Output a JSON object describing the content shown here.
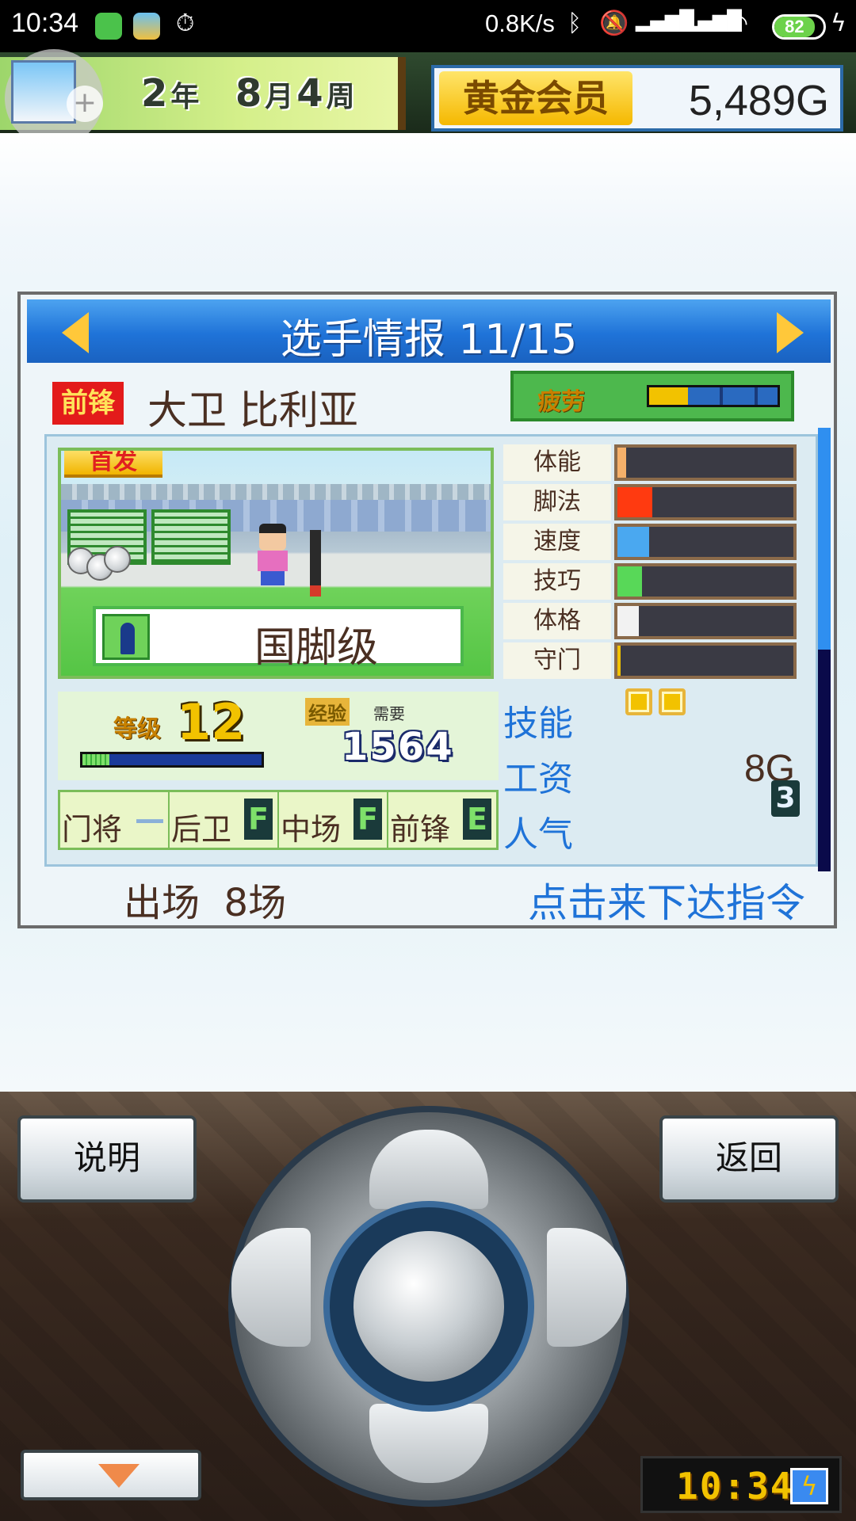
{
  "status_bar": {
    "time": "10:34",
    "net_speed": "0.8K/s",
    "battery": "82",
    "icons": [
      "game-app-icon",
      "photo-app-icon",
      "timer-icon",
      "bluetooth-icon",
      "mute-icon",
      "signal-hd-icon",
      "signal-hd-icon",
      "wifi-icon",
      "charging-icon"
    ]
  },
  "header": {
    "year": "2",
    "year_unit": "年",
    "month": "8",
    "month_unit": "月",
    "week": "4",
    "week_unit": "周",
    "member_label": "黄金会员",
    "gold": "5,489G"
  },
  "card": {
    "title": "选手情报 11/15",
    "position_tag": "前锋",
    "player_name": "大卫 比利亚",
    "fatigue_label": "疲劳",
    "fatigue": {
      "yellow": 0.3,
      "blue": 0.7
    },
    "start_tag": "首发",
    "rank": "国脚级",
    "level_label": "等级",
    "level": "12",
    "exp_label": "经验",
    "exp_need_label": "需要",
    "exp_need": "1564",
    "exp_progress": 0.15,
    "positions": [
      {
        "name": "门将",
        "grade": "—"
      },
      {
        "name": "后卫",
        "grade": "F"
      },
      {
        "name": "中场",
        "grade": "F"
      },
      {
        "name": "前锋",
        "grade": "E"
      }
    ],
    "stats": [
      {
        "label": "体能",
        "value": 0.05,
        "color": "#f5b06a"
      },
      {
        "label": "脚法",
        "value": 0.2,
        "color": "#ff3a10"
      },
      {
        "label": "速度",
        "value": 0.18,
        "color": "#4aa8f0"
      },
      {
        "label": "技巧",
        "value": 0.14,
        "color": "#58d858"
      },
      {
        "label": "体格",
        "value": 0.12,
        "color": "#f2f2f2"
      },
      {
        "label": "守门",
        "value": 0.02,
        "color": "#f2c200"
      }
    ],
    "skill_label": "技能",
    "salary_label": "工资",
    "salary": "8G",
    "popularity_label": "人气",
    "popularity": "3",
    "appearances_label": "出场",
    "appearances": "8场",
    "command_link": "点击来下达指令"
  },
  "controls": {
    "help_button": "说明",
    "back_button": "返回",
    "clock": "10:34"
  },
  "colors": {
    "accent_blue": "#1f73d8",
    "text_brown": "#4a2f22",
    "gold": "#f2c200"
  }
}
